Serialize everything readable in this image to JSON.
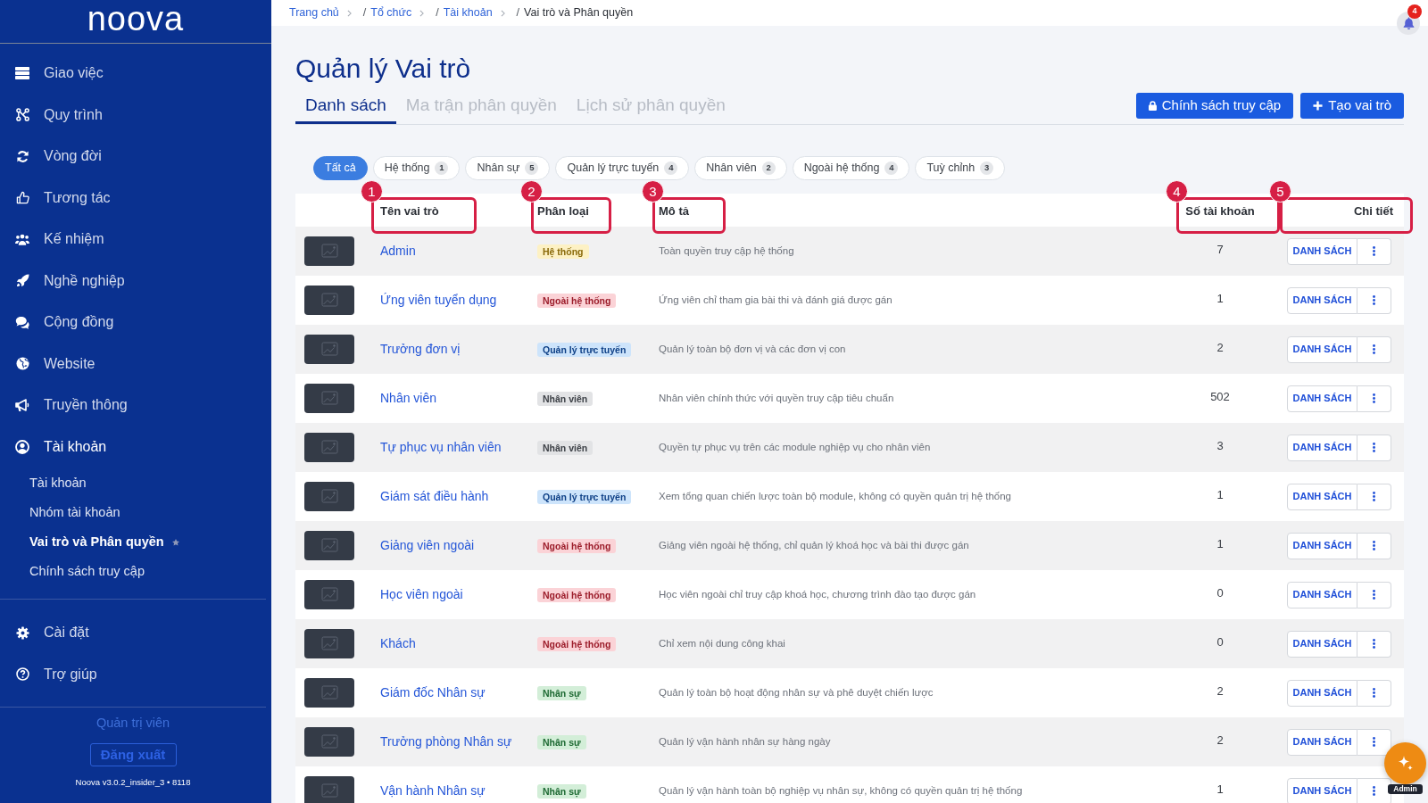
{
  "sidebar": {
    "logo": "noova",
    "nav": [
      {
        "label": "Giao việc",
        "selected": false
      },
      {
        "label": "Quy trình",
        "selected": false
      },
      {
        "label": "Vòng đời",
        "selected": false
      },
      {
        "label": "Tương tác",
        "selected": false
      },
      {
        "label": "Kế nhiệm",
        "selected": false
      },
      {
        "label": "Nghề nghiệp",
        "selected": false
      },
      {
        "label": "Cộng đồng",
        "selected": false
      },
      {
        "label": "Website",
        "selected": false
      },
      {
        "label": "Truyền thông",
        "selected": false
      },
      {
        "label": "Tài khoản",
        "selected": true,
        "children": [
          {
            "label": "Tài khoản",
            "selected": false,
            "starred": false
          },
          {
            "label": "Nhóm tài khoản",
            "selected": false,
            "starred": false
          },
          {
            "label": "Vai trò và Phân quyền",
            "selected": true,
            "starred": true
          },
          {
            "label": "Chính sách truy cập",
            "selected": false,
            "starred": false
          }
        ]
      }
    ],
    "bottom_nav": [
      {
        "label": "Cài đặt",
        "selected": false
      },
      {
        "label": "Trợ giúp",
        "selected": false
      }
    ],
    "user_role": "Quản trị viên",
    "logout_button": "Đăng xuất",
    "version": "Noova v3.0.2_insider_3 • 8118"
  },
  "breadcrumb": [
    {
      "label": "Trang chủ",
      "current": false
    },
    {
      "separator": "/",
      "label": "Tổ chức",
      "current": false
    },
    {
      "separator": "/",
      "label": "Tài khoản",
      "current": false
    },
    {
      "separator": "/",
      "label": "Vai trò và Phân quyền",
      "current": true
    }
  ],
  "notifications": {
    "count": "4"
  },
  "page_title": "Quản lý Vai trò",
  "tabs": [
    {
      "label": "Danh sách",
      "selected": true
    },
    {
      "label": "Ma trận phân quyền",
      "selected": false
    },
    {
      "label": "Lịch sử phân quyền",
      "selected": false
    }
  ],
  "actions": [
    {
      "label": "Chính sách truy cập"
    },
    {
      "label": "Tạo vai trò"
    }
  ],
  "filters": [
    {
      "label": "Tất cả",
      "selected": true
    },
    {
      "label": "Hệ thống",
      "count": "1",
      "selected": false
    },
    {
      "label": "Nhân sự",
      "count": "5",
      "selected": false
    },
    {
      "label": "Quản lý trực tuyến",
      "count": "4",
      "selected": false
    },
    {
      "label": "Nhân viên",
      "count": "2",
      "selected": false
    },
    {
      "label": "Ngoài hệ thống",
      "count": "4",
      "selected": false
    },
    {
      "label": "Tuỳ chỉnh",
      "count": "3",
      "selected": false
    }
  ],
  "table": {
    "columns": [
      {
        "label": "Tên vai trò",
        "marker": "1"
      },
      {
        "label": "Phân loại",
        "marker": "2"
      },
      {
        "label": "Mô tả",
        "marker": "3"
      },
      {
        "label": "Số tài khoản",
        "marker": "4"
      },
      {
        "label": "Chi tiết",
        "marker": "5"
      }
    ],
    "rows": [
      {
        "name": "Admin",
        "tag": {
          "label": "Hệ thống",
          "kind": "system"
        },
        "description": "Toàn quyền truy cập hệ thống",
        "accounts": "7",
        "action": "DANH SÁCH"
      },
      {
        "name": "Ứng viên tuyển dụng",
        "tag": {
          "label": "Ngoài hệ thống",
          "kind": "external"
        },
        "description": "Ứng viên chỉ tham gia bài thi và đánh giá được gán",
        "accounts": "1",
        "action": "DANH SÁCH"
      },
      {
        "name": "Trưởng đơn vị",
        "tag": {
          "label": "Quản lý trực tuyến",
          "kind": "online"
        },
        "description": "Quản lý toàn bộ đơn vị và các đơn vị con",
        "accounts": "2",
        "action": "DANH SÁCH"
      },
      {
        "name": "Nhân viên",
        "tag": {
          "label": "Nhân viên",
          "kind": "employee"
        },
        "description": "Nhân viên chính thức với quyền truy cập tiêu chuẩn",
        "accounts": "502",
        "action": "DANH SÁCH"
      },
      {
        "name": "Tự phục vụ nhân viên",
        "tag": {
          "label": "Nhân viên",
          "kind": "employee"
        },
        "description": "Quyền tự phục vụ trên các module nghiệp vụ cho nhân viên",
        "accounts": "3",
        "action": "DANH SÁCH"
      },
      {
        "name": "Giám sát điều hành",
        "tag": {
          "label": "Quản lý trực tuyến",
          "kind": "online"
        },
        "description": "Xem tổng quan chiến lược toàn bộ module, không có quyền quản trị hệ thống",
        "accounts": "1",
        "action": "DANH SÁCH"
      },
      {
        "name": "Giảng viên ngoài",
        "tag": {
          "label": "Ngoài hệ thống",
          "kind": "external"
        },
        "description": "Giảng viên ngoài hệ thống, chỉ quản lý khoá học và bài thi được gán",
        "accounts": "1",
        "action": "DANH SÁCH"
      },
      {
        "name": "Học viên ngoài",
        "tag": {
          "label": "Ngoài hệ thống",
          "kind": "external"
        },
        "description": "Học viên ngoài chỉ truy cập khoá học, chương trình đào tạo được gán",
        "accounts": "0",
        "action": "DANH SÁCH"
      },
      {
        "name": "Khách",
        "tag": {
          "label": "Ngoài hệ thống",
          "kind": "external"
        },
        "description": "Chỉ xem nội dung công khai",
        "accounts": "0",
        "action": "DANH SÁCH"
      },
      {
        "name": "Giám đốc Nhân sự",
        "tag": {
          "label": "Nhân sự",
          "kind": "hr"
        },
        "description": "Quản lý toàn bộ hoạt động nhân sự và phê duyệt chiến lược",
        "accounts": "2",
        "action": "DANH SÁCH"
      },
      {
        "name": "Trưởng phòng Nhân sự",
        "tag": {
          "label": "Nhân sự",
          "kind": "hr"
        },
        "description": "Quản lý vận hành nhân sự hàng ngày",
        "accounts": "2",
        "action": "DANH SÁCH"
      },
      {
        "name": "Vận hành Nhân sự",
        "tag": {
          "label": "Nhân sự",
          "kind": "hr"
        },
        "description": "Quản lý vận hành toàn bộ nghiệp vụ nhân sự, không có quyền quản trị hệ thống",
        "accounts": "1",
        "action": "DANH SÁCH"
      }
    ]
  },
  "assistant": {
    "label": "Admin"
  }
}
